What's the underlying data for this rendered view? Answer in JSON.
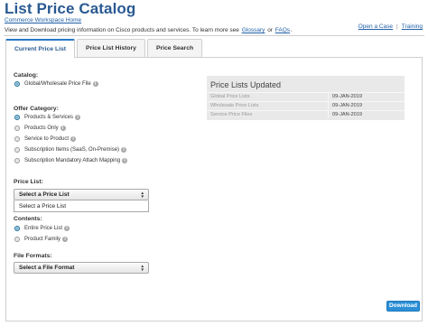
{
  "header": {
    "title": "List Price Catalog",
    "breadcrumb": "Commerce Workspace Home",
    "intro_text": "View and Download pricing information on Cisco products and services. To learn more see",
    "glossary_link": "Glossary",
    "or_text": "or",
    "faqs_link": "FAQs",
    "period": ".",
    "open_case": "Open a Case",
    "separator": "|",
    "training": "Training"
  },
  "tabs": [
    {
      "label": "Current Price List",
      "active": true
    },
    {
      "label": "Price List History",
      "active": false
    },
    {
      "label": "Price Search",
      "active": false
    }
  ],
  "catalog": {
    "label": "Catalog:",
    "options": [
      {
        "label": "Global/Wholesale Price File",
        "checked": true
      }
    ]
  },
  "offer_category": {
    "label": "Offer Category:",
    "options": [
      {
        "label": "Products & Services",
        "checked": true,
        "info": true
      },
      {
        "label": "Products Only",
        "checked": false,
        "info": true
      },
      {
        "label": "Service to Product",
        "checked": false,
        "info": true
      },
      {
        "label": "Subscription Items (SaaS, On-Premise)",
        "checked": false,
        "info": true
      },
      {
        "label": "Subscription Mandatory Attach Mapping",
        "checked": false,
        "info": true
      }
    ]
  },
  "price_list": {
    "label": "Price List:",
    "selected": "Select a Price List",
    "dropdown_option": "Select a Price List"
  },
  "contents": {
    "label": "Contents:",
    "options": [
      {
        "label": "Entire Price List",
        "checked": true,
        "info": true
      },
      {
        "label": "Product Family",
        "checked": false,
        "info": true
      }
    ]
  },
  "file_formats": {
    "label": "File Formats:",
    "selected": "Select a File Format"
  },
  "updated_box": {
    "title": "Price Lists Updated",
    "rows": [
      {
        "name": "Global Price Lists",
        "date": "09-JAN-2019"
      },
      {
        "name": "Wholesale Price Lists",
        "date": "09-JAN-2019"
      },
      {
        "name": "Service Price Files",
        "date": "09-JAN-2019"
      }
    ]
  },
  "download_label": "Download",
  "info_glyph": "i",
  "colors": {
    "title": "#2a5a92",
    "accent": "#2a8fd6",
    "radio_checked": "#1f6e9a"
  }
}
